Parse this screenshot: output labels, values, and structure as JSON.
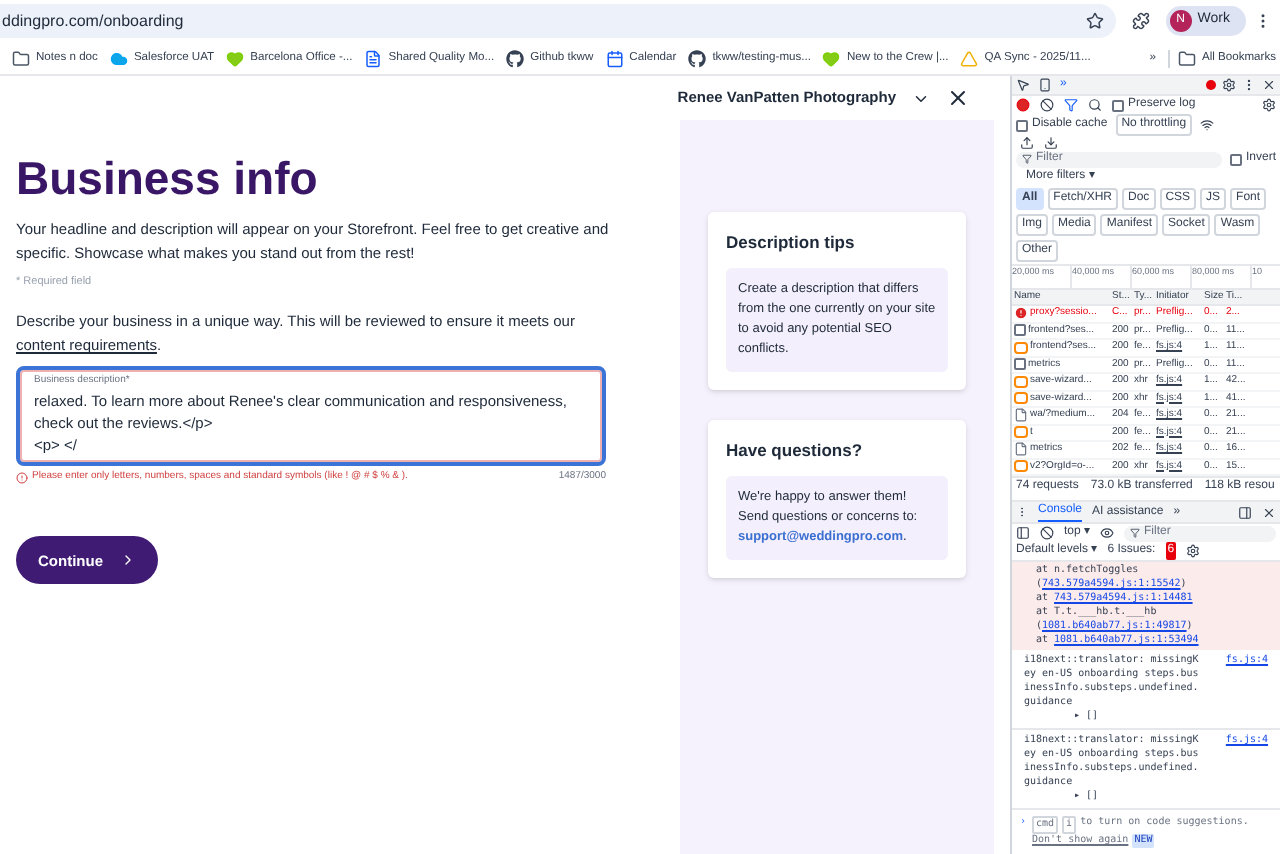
{
  "browser": {
    "url": "ddingpro.com/onboarding",
    "profile_initial": "N",
    "profile_name": "Work",
    "bookmarks": [
      {
        "kind": "folder",
        "label": "Notes n doc"
      },
      {
        "kind": "cloud",
        "label": "Salesforce UAT"
      },
      {
        "kind": "heart",
        "label": "Barcelona Office -..."
      },
      {
        "kind": "doc",
        "label": "Shared Quality Mo..."
      },
      {
        "kind": "github",
        "label": "Github tkww"
      },
      {
        "kind": "calendar",
        "label": "Calendar"
      },
      {
        "kind": "github",
        "label": "tkww/testing-mus..."
      },
      {
        "kind": "heart",
        "label": "New to the Crew |..."
      },
      {
        "kind": "drive",
        "label": "QA Sync - 2025/11..."
      }
    ],
    "more_bookmarks": "»",
    "all_bookmarks": "All Bookmarks"
  },
  "page": {
    "header": {
      "business": "Renee VanPatten Photography"
    },
    "title": "Business info",
    "intro": "Your headline and description will appear on your Storefront. Feel free to get creative and specific. Showcase what makes you stand out from the rest!",
    "required_note": "* Required field",
    "prompt": "Describe your business in a unique way. This will be reviewed to ensure it meets our ",
    "prompt_link": "content requirements",
    "prompt_end": ".",
    "field": {
      "label": "Business description*",
      "value": "relaxed. To learn more about Renee's clear communication and responsiveness, check out the reviews.</p>\n<p> </",
      "error": "Please enter only letters, numbers, spaces and standard symbols (like ! @ # $ % & ).",
      "counter": "1487/3000",
      "invalid": true
    },
    "continue": "Continue",
    "tips": {
      "title": "Description tips",
      "text": "Create a description that differs from the one currently on your site to avoid any potential SEO conflicts."
    },
    "questions": {
      "title": "Have questions?",
      "text": "We're happy to answer them! Send questions or concerns to: ",
      "email": "support@weddingpro.com",
      "end": "."
    }
  },
  "devtools": {
    "top_more": "»",
    "preserve_log": {
      "label": "Preserve log",
      "checked": false
    },
    "disable_cache": {
      "label": "Disable cache",
      "checked": false
    },
    "throttling": "No throttling",
    "filter_placeholder": "Filter",
    "invert": {
      "label": "Invert",
      "checked": false
    },
    "more_filters": "More filters ▾",
    "chips": [
      {
        "label": "All",
        "selected": true
      },
      {
        "label": "Fetch/XHR",
        "selected": false
      },
      {
        "label": "Doc",
        "selected": false
      },
      {
        "label": "CSS",
        "selected": false
      },
      {
        "label": "JS",
        "selected": false
      },
      {
        "label": "Font",
        "selected": false
      },
      {
        "label": "Img",
        "selected": false
      },
      {
        "label": "Media",
        "selected": false
      },
      {
        "label": "Manifest",
        "selected": false
      },
      {
        "label": "Socket",
        "selected": false
      },
      {
        "label": "Wasm",
        "selected": false
      },
      {
        "label": "Other",
        "selected": false
      }
    ],
    "timeline_ticks": [
      "20,000 ms",
      "40,000 ms",
      "60,000 ms",
      "80,000 ms",
      "10"
    ],
    "columns": [
      "Name",
      "St...",
      "Ty...",
      "Initiator",
      "Size",
      "Ti..."
    ],
    "rows": [
      {
        "kind": "error",
        "failed": true,
        "cells": [
          "proxy?sessio...",
          "C...",
          "pr...",
          "Preflig...",
          "0...",
          "2..."
        ]
      },
      {
        "kind": "box",
        "failed": false,
        "cells": [
          "frontend?ses...",
          "200",
          "pr...",
          "Preflig...",
          "0...",
          "11..."
        ]
      },
      {
        "kind": "fetch",
        "failed": false,
        "cells": [
          "frontend?ses...",
          "200",
          "fe...",
          "fs.js:4",
          "1...",
          "11..."
        ]
      },
      {
        "kind": "box",
        "failed": false,
        "cells": [
          "metrics",
          "200",
          "pr...",
          "Preflig...",
          "0...",
          "11..."
        ]
      },
      {
        "kind": "fetch",
        "failed": false,
        "cells": [
          "save-wizard...",
          "200",
          "xhr",
          "fs.js:4",
          "1...",
          "42..."
        ]
      },
      {
        "kind": "fetch",
        "failed": false,
        "cells": [
          "save-wizard...",
          "200",
          "xhr",
          "fs.js:4",
          "1...",
          "41..."
        ]
      },
      {
        "kind": "file",
        "failed": false,
        "cells": [
          "wa/?medium...",
          "204",
          "fe...",
          "fs.js:4",
          "0...",
          "21..."
        ]
      },
      {
        "kind": "fetch",
        "failed": false,
        "cells": [
          "t",
          "200",
          "fe...",
          "fs.js:4",
          "0...",
          "21..."
        ]
      },
      {
        "kind": "file",
        "failed": false,
        "cells": [
          "metrics",
          "202",
          "fe...",
          "fs.js:4",
          "0...",
          "16..."
        ]
      },
      {
        "kind": "fetch",
        "failed": false,
        "cells": [
          "v2?OrgId=o-...",
          "200",
          "xhr",
          "fs.js:4",
          "0...",
          "15..."
        ]
      }
    ],
    "summary": [
      "74 requests",
      "73.0 kB transferred",
      "118 kB resou"
    ],
    "drawer_tabs": [
      {
        "label": "Console",
        "selected": true
      },
      {
        "label": "AI assistance",
        "selected": false
      }
    ],
    "drawer_more": "»",
    "context": "top ▾",
    "console_filter": "Filter",
    "levels": "Default levels ▾",
    "issues": "6 Issues:",
    "issues_count": "6",
    "stack": [
      {
        "text": "at n.fetchToggles (",
        "link": "743.579a4594.js:1:15542",
        "tail": ")"
      },
      {
        "text": "at ",
        "link": "743.579a4594.js:1:14481"
      },
      {
        "text": "at T.t.___hb.t.___hb (",
        "link": "1081.b640ab77.js:1:49817",
        "tail": ")"
      },
      {
        "text": "at ",
        "link": "1081.b640ab77.js:1:53494"
      }
    ],
    "logs": [
      {
        "message": "i18next::translator: missingKey en-US onboarding steps.businessInfo.substeps.undefined.guidance",
        "source": "fs.js:4",
        "value": "▸ []"
      },
      {
        "message": "i18next::translator: missingKey en-US onboarding steps.businessInfo.substeps.undefined.guidance",
        "source": "fs.js:4",
        "value": "▸ []"
      }
    ],
    "prompt": {
      "arrow": "›",
      "key1": "cmd",
      "key2": "i",
      "text": "to turn on code suggestions.",
      "link": "Don't show again",
      "badge": "NEW"
    }
  }
}
